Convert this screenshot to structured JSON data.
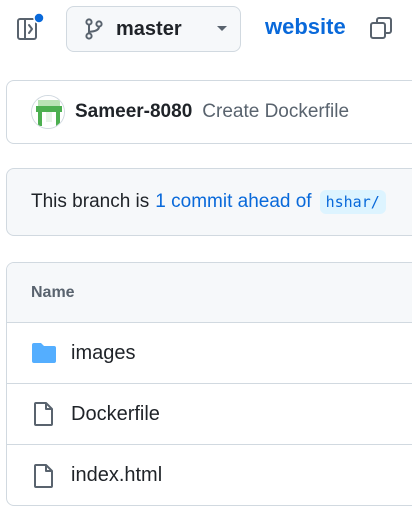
{
  "header": {
    "branch_name": "master",
    "repo_name": "website"
  },
  "commit": {
    "author": "Sameer-8080",
    "message": "Create Dockerfile"
  },
  "branch_status": {
    "prefix": "This branch is",
    "ahead_link": "1 commit ahead of",
    "ref": "hshar/"
  },
  "file_table": {
    "header": "Name",
    "rows": [
      {
        "name": "images",
        "icon": "folder-icon"
      },
      {
        "name": "Dockerfile",
        "icon": "file-icon"
      },
      {
        "name": "index.html",
        "icon": "file-icon"
      }
    ]
  },
  "colors": {
    "accent": "#0969da",
    "notification_dot": "#0969da",
    "folder": "#54aeff",
    "border": "#d1d9e0",
    "muted_bg": "#f6f8fa"
  }
}
